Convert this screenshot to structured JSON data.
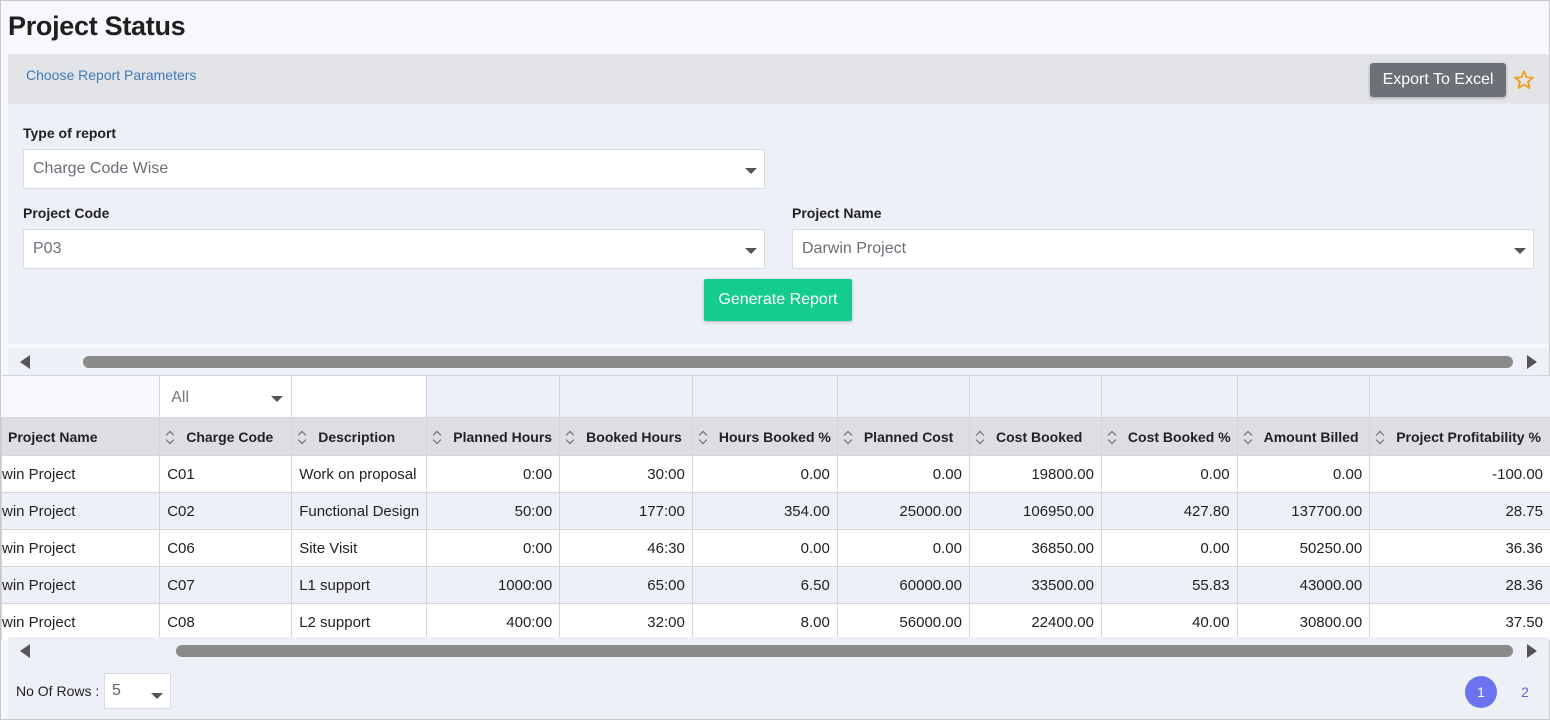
{
  "page": {
    "title": "Project Status"
  },
  "params_bar": {
    "link_label": "Choose Report Parameters",
    "export_label": "Export To Excel",
    "favorite_icon": "star-icon",
    "favorite_color": "#f0a020"
  },
  "form": {
    "report_type": {
      "label": "Type of report",
      "value": "Charge Code Wise"
    },
    "project_code": {
      "label": "Project Code",
      "value": "P03"
    },
    "project_name": {
      "label": "Project Name",
      "value": "Darwin Project"
    },
    "generate_label": "Generate Report",
    "generate_color": "#14cc8e"
  },
  "table": {
    "charge_code_filter": "All",
    "columns": [
      "Project Name",
      "Charge Code",
      "Description",
      "Planned Hours",
      "Booked Hours",
      "Hours Booked %",
      "Planned Cost",
      "Cost Booked",
      "Cost Booked %",
      "Amount Billed",
      "Project Profitability %"
    ],
    "rows": [
      [
        "win Project",
        "C01",
        "Work on proposal",
        "0:00",
        "30:00",
        "0.00",
        "0.00",
        "19800.00",
        "0.00",
        "0.00",
        "-100.00"
      ],
      [
        "win Project",
        "C02",
        "Functional Design",
        "50:00",
        "177:00",
        "354.00",
        "25000.00",
        "106950.00",
        "427.80",
        "137700.00",
        "28.75"
      ],
      [
        "win Project",
        "C06",
        "Site Visit",
        "0:00",
        "46:30",
        "0.00",
        "0.00",
        "36850.00",
        "0.00",
        "50250.00",
        "36.36"
      ],
      [
        "win Project",
        "C07",
        "L1 support",
        "1000:00",
        "65:00",
        "6.50",
        "60000.00",
        "33500.00",
        "55.83",
        "43000.00",
        "28.36"
      ],
      [
        "win Project",
        "C08",
        "L2 support",
        "400:00",
        "32:00",
        "8.00",
        "56000.00",
        "22400.00",
        "40.00",
        "30800.00",
        "37.50"
      ]
    ]
  },
  "footer": {
    "rows_label": "No Of Rows :",
    "rows_value": "5",
    "pages": [
      "1",
      "2"
    ],
    "active_page_color": "#6d72f0"
  }
}
